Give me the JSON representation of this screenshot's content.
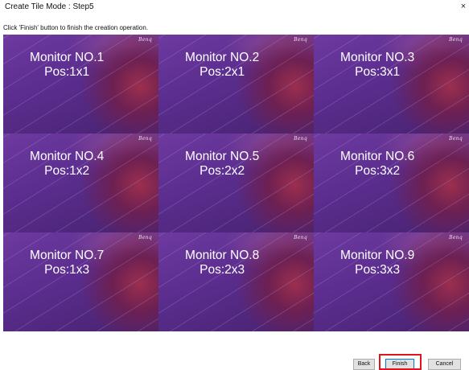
{
  "window": {
    "title": "Create Tile Mode : Step5",
    "close_glyph": "×"
  },
  "instruction": "Click 'Finish' button to finish the creation operation.",
  "tiles": [
    {
      "monitor": "Monitor NO.1",
      "pos": "Pos:1x1",
      "logo": "Benq"
    },
    {
      "monitor": "Monitor NO.2",
      "pos": "Pos:2x1",
      "logo": "Benq"
    },
    {
      "monitor": "Monitor NO.3",
      "pos": "Pos:3x1",
      "logo": "Benq"
    },
    {
      "monitor": "Monitor NO.4",
      "pos": "Pos:1x2",
      "logo": "Benq"
    },
    {
      "monitor": "Monitor NO.5",
      "pos": "Pos:2x2",
      "logo": "Benq"
    },
    {
      "monitor": "Monitor NO.6",
      "pos": "Pos:3x2",
      "logo": "Benq"
    },
    {
      "monitor": "Monitor NO.7",
      "pos": "Pos:1x3",
      "logo": "Benq"
    },
    {
      "monitor": "Monitor NO.8",
      "pos": "Pos:2x3",
      "logo": "Benq"
    },
    {
      "monitor": "Monitor NO.9",
      "pos": "Pos:3x3",
      "logo": "Benq"
    }
  ],
  "buttons": {
    "back": "Back",
    "finish": "Finish",
    "cancel": "Cancel"
  },
  "colors": {
    "tile_purple": "#5a2d8e",
    "highlight_red": "#e0141e",
    "default_button_border": "#0078d7"
  }
}
